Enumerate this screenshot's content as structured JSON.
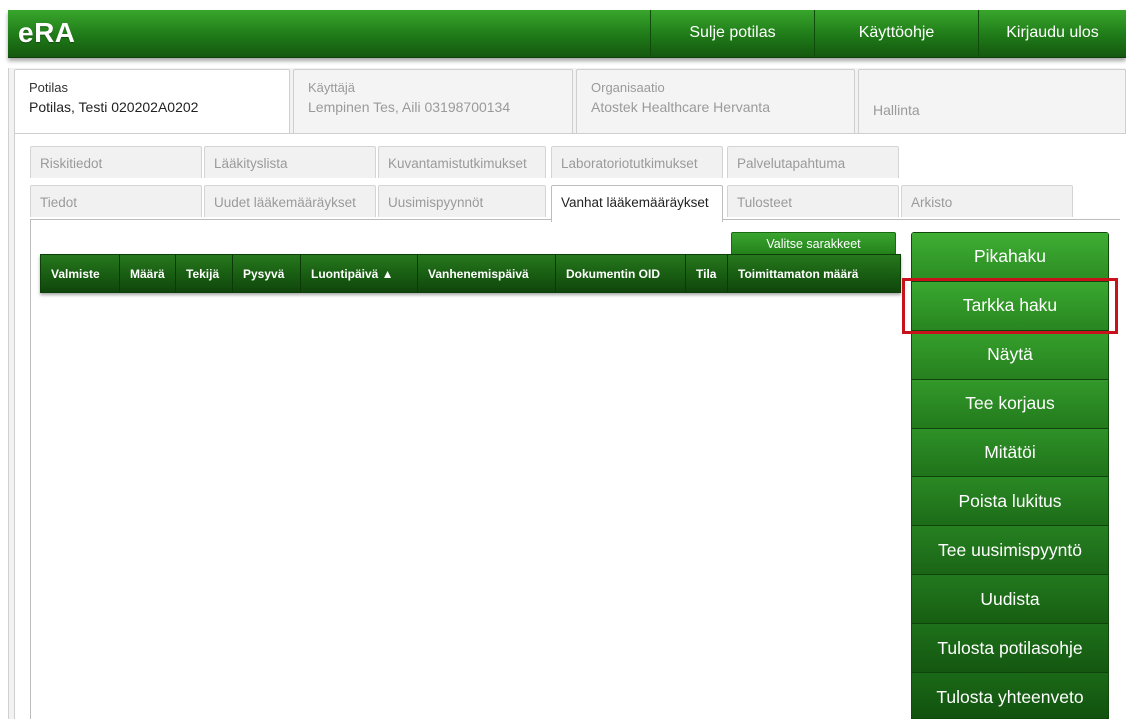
{
  "header": {
    "logo": "eRA",
    "nav": [
      "Sulje potilas",
      "Käyttöohje",
      "Kirjaudu ulos"
    ]
  },
  "context_tabs": [
    {
      "label": "Potilas",
      "value": "Potilas, Testi 020202A0202",
      "active": true
    },
    {
      "label": "Käyttäjä",
      "value": "Lempinen Tes, Aili 03198700134",
      "active": false
    },
    {
      "label": "Organisaatio",
      "value": "Atostek Healthcare Hervanta",
      "active": false
    },
    {
      "label": "",
      "value": "Hallinta",
      "active": false
    }
  ],
  "subtabs_row1": [
    "Riskitiedot",
    "Lääkityslista",
    "Kuvantamistutkimukset",
    "Laboratoriotutkimukset",
    "Palvelutapahtuma"
  ],
  "subtabs_row2": [
    "Tiedot",
    "Uudet lääkemääräykset",
    "Uusimispyynnöt",
    "Vanhat lääkemääräykset",
    "Tulosteet",
    "Arkisto"
  ],
  "active_subtab": "Vanhat lääkemääräykset",
  "choose_columns_label": "Valitse sarakkeet",
  "table": {
    "columns": [
      "Valmiste",
      "Määrä",
      "Tekijä",
      "Pysyvä",
      "Luontipäivä ▲",
      "Vanhenemispäivä",
      "Dokumentin OID",
      "Tila",
      "Toimittamaton määrä"
    ],
    "rows": []
  },
  "actions": [
    "Pikahaku",
    "Tarkka haku",
    "Näytä",
    "Tee korjaus",
    "Mitätöi",
    "Poista lukitus",
    "Tee uusimispyyntö",
    "Uudista",
    "Tulosta potilasohje",
    "Tulosta yhteenveto"
  ],
  "highlighted_action": "Tarkka haku",
  "colors": {
    "brand_green": "#1f7a18",
    "highlight_red": "#c8121b"
  }
}
